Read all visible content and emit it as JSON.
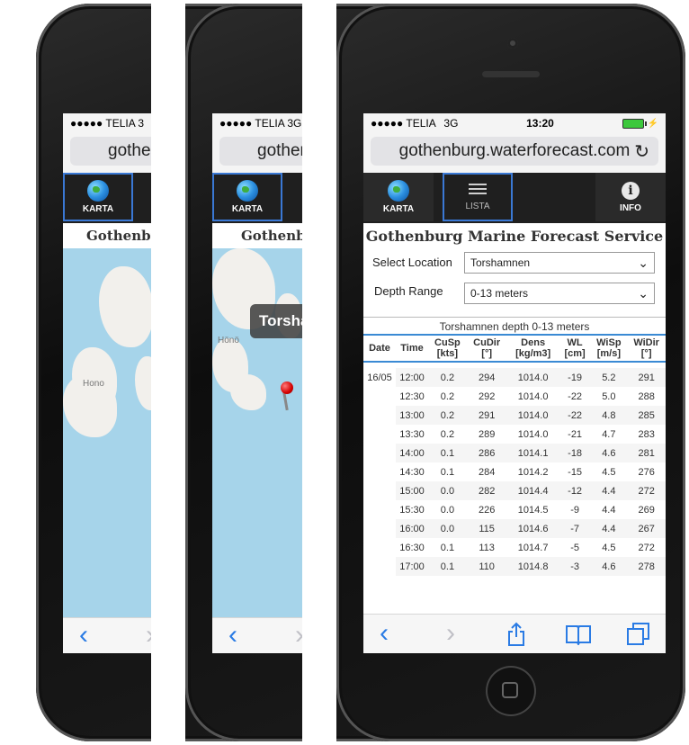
{
  "status": {
    "carrier": "●●●●● TELIA",
    "network": "3G",
    "time": "13:20",
    "carrier_short_1": "●●●●● TELIA  3",
    "carrier_short_2": "●●●●● TELIA  3G"
  },
  "browser": {
    "url": "gothenburg.waterforecast.com",
    "url_clipped": "gothenb",
    "reload_icon": "reload-icon"
  },
  "nav": {
    "karta": "KARTA",
    "lista": "LISTA",
    "info": "INFO",
    "info_glyph": "i"
  },
  "app": {
    "title": "Gothenburg Marine Forecast Service",
    "title_clip_1": "Gothenbu",
    "title_clip_2": "Gothenbu"
  },
  "map": {
    "place_label": "Hönö",
    "place_label_2": "Hono",
    "popup": "Torsha"
  },
  "form": {
    "location_label": "Select Location",
    "location_value": "Torshamnen",
    "depth_label": "Depth Range",
    "depth_value": "0-13 meters"
  },
  "table": {
    "caption": "Torshamnen depth 0-13 meters",
    "headers": [
      {
        "name": "Date",
        "unit": ""
      },
      {
        "name": "Time",
        "unit": ""
      },
      {
        "name": "CuSp",
        "unit": "[kts]"
      },
      {
        "name": "CuDir",
        "unit": "[°]"
      },
      {
        "name": "Dens",
        "unit": "[kg/m3]"
      },
      {
        "name": "WL",
        "unit": "[cm]"
      },
      {
        "name": "WiSp",
        "unit": "[m/s]"
      },
      {
        "name": "WiDir",
        "unit": "[°]"
      }
    ],
    "rows": [
      [
        "16/05",
        "12:00",
        "0.2",
        "294",
        "1014.0",
        "-19",
        "5.2",
        "291"
      ],
      [
        "",
        "12:30",
        "0.2",
        "292",
        "1014.0",
        "-22",
        "5.0",
        "288"
      ],
      [
        "",
        "13:00",
        "0.2",
        "291",
        "1014.0",
        "-22",
        "4.8",
        "285"
      ],
      [
        "",
        "13:30",
        "0.2",
        "289",
        "1014.0",
        "-21",
        "4.7",
        "283"
      ],
      [
        "",
        "14:00",
        "0.1",
        "286",
        "1014.1",
        "-18",
        "4.6",
        "281"
      ],
      [
        "",
        "14:30",
        "0.1",
        "284",
        "1014.2",
        "-15",
        "4.5",
        "276"
      ],
      [
        "",
        "15:00",
        "0.0",
        "282",
        "1014.4",
        "-12",
        "4.4",
        "272"
      ],
      [
        "",
        "15:30",
        "0.0",
        "226",
        "1014.5",
        "-9",
        "4.4",
        "269"
      ],
      [
        "",
        "16:00",
        "0.0",
        "115",
        "1014.6",
        "-7",
        "4.4",
        "267"
      ],
      [
        "",
        "16:30",
        "0.1",
        "113",
        "1014.7",
        "-5",
        "4.5",
        "272"
      ],
      [
        "",
        "17:00",
        "0.1",
        "110",
        "1014.8",
        "-3",
        "4.6",
        "278"
      ]
    ]
  },
  "toolbar": {
    "back": "‹",
    "forward": "›",
    "share": "share-icon",
    "bookmarks": "book-icon",
    "tabs": "tabs-icon"
  },
  "colors": {
    "accent": "#2a7be4",
    "nav_bg": "#1f1f1f",
    "active_border": "#3a78d4",
    "map_water": "#a6d4ea",
    "pin": "#d40000"
  }
}
